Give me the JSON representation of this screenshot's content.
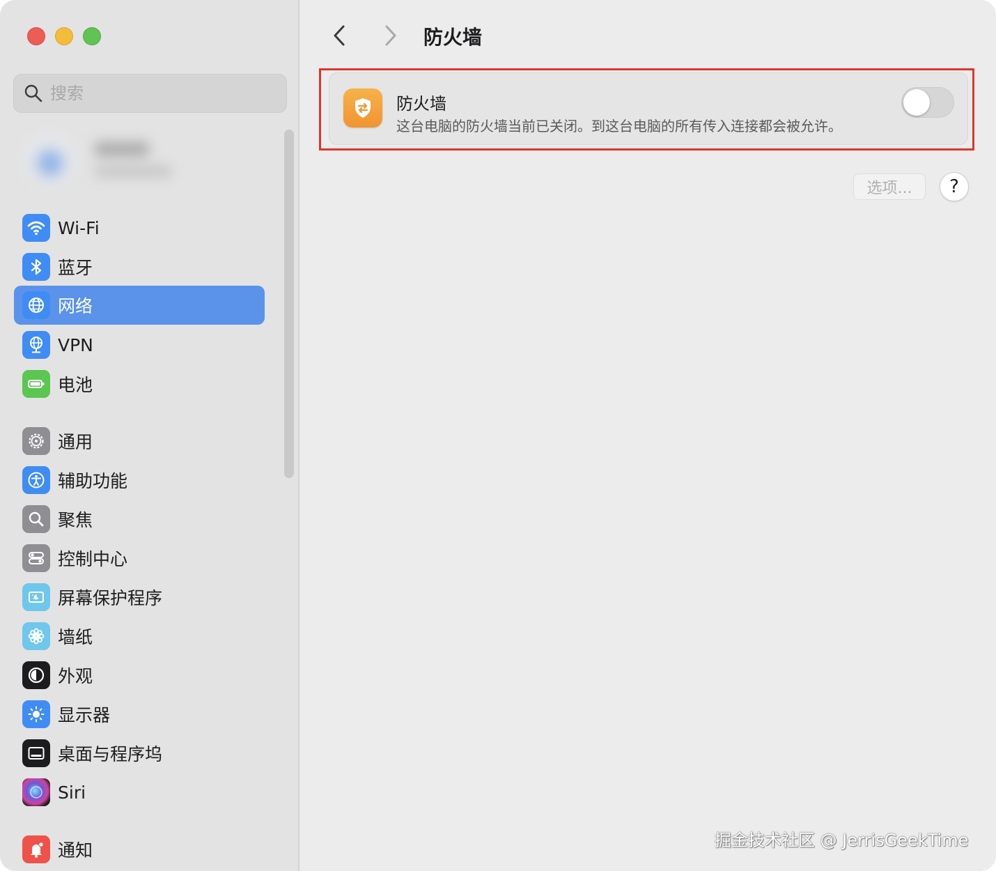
{
  "sidebar": {
    "search_placeholder": "搜索",
    "items": [
      {
        "label": "Wi-Fi",
        "icon": "wifi-icon"
      },
      {
        "label": "蓝牙",
        "icon": "bluetooth-icon"
      },
      {
        "label": "网络",
        "icon": "globe-icon"
      },
      {
        "label": "VPN",
        "icon": "vpn-globe-icon"
      },
      {
        "label": "电池",
        "icon": "battery-icon"
      },
      {
        "label": "通用",
        "icon": "gear-icon"
      },
      {
        "label": "辅助功能",
        "icon": "accessibility-icon"
      },
      {
        "label": "聚焦",
        "icon": "spotlight-icon"
      },
      {
        "label": "控制中心",
        "icon": "control-center-icon"
      },
      {
        "label": "屏幕保护程序",
        "icon": "screensaver-icon"
      },
      {
        "label": "墙纸",
        "icon": "wallpaper-flower-icon"
      },
      {
        "label": "外观",
        "icon": "appearance-icon"
      },
      {
        "label": "显示器",
        "icon": "display-sun-icon"
      },
      {
        "label": "桌面与程序坞",
        "icon": "dock-icon"
      },
      {
        "label": "Siri",
        "icon": "siri-icon"
      },
      {
        "label": "通知",
        "icon": "notifications-icon"
      }
    ],
    "selected_item": "网络"
  },
  "main": {
    "title": "防火墙",
    "firewall": {
      "title": "防火墙",
      "description": "这台电脑的防火墙当前已关闭。到这台电脑的所有传入连接都会被允许。",
      "enabled": false,
      "icon": "firewall-shield-icon"
    },
    "options_label": "选项...",
    "help_label": "?"
  },
  "watermark": "掘金技术社区 @ JerrisGeekTime",
  "colors": {
    "selection": "#5b92ea",
    "highlight_border": "#e0352b",
    "firewall_icon": "#f09431"
  }
}
